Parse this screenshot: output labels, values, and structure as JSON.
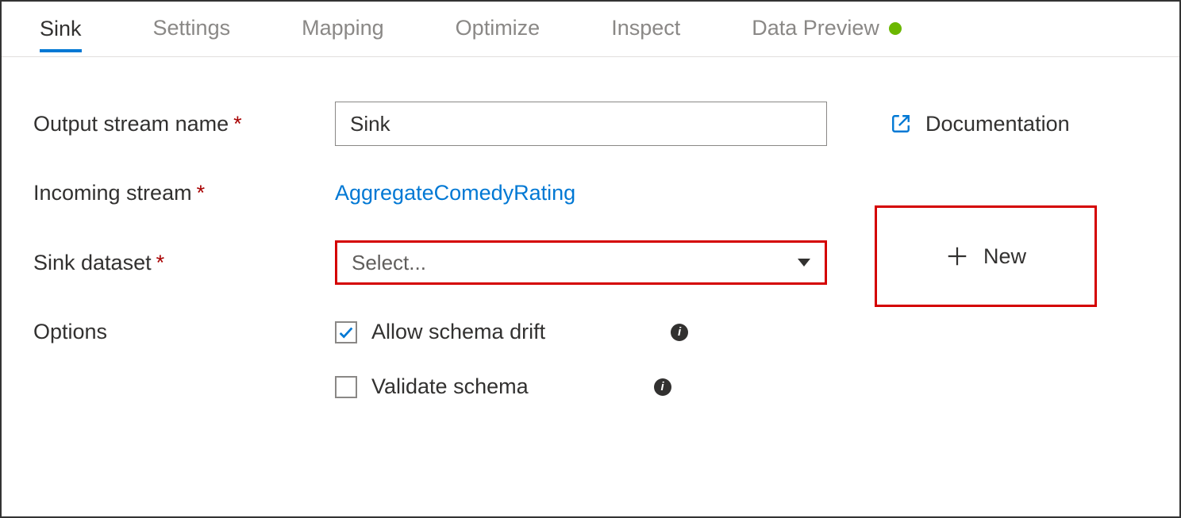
{
  "tabs": {
    "items": [
      {
        "label": "Sink",
        "active": true
      },
      {
        "label": "Settings",
        "active": false
      },
      {
        "label": "Mapping",
        "active": false
      },
      {
        "label": "Optimize",
        "active": false
      },
      {
        "label": "Inspect",
        "active": false
      },
      {
        "label": "Data Preview",
        "active": false,
        "status": "green"
      }
    ]
  },
  "documentation_label": "Documentation",
  "form": {
    "output_stream_label": "Output stream name",
    "output_stream_value": "Sink",
    "incoming_stream_label": "Incoming stream",
    "incoming_stream_value": "AggregateComedyRating",
    "sink_dataset_label": "Sink dataset",
    "sink_dataset_placeholder": "Select...",
    "new_button_label": "New",
    "options_label": "Options",
    "allow_schema_drift_label": "Allow schema drift",
    "allow_schema_drift_checked": true,
    "validate_schema_label": "Validate schema",
    "validate_schema_checked": false
  }
}
